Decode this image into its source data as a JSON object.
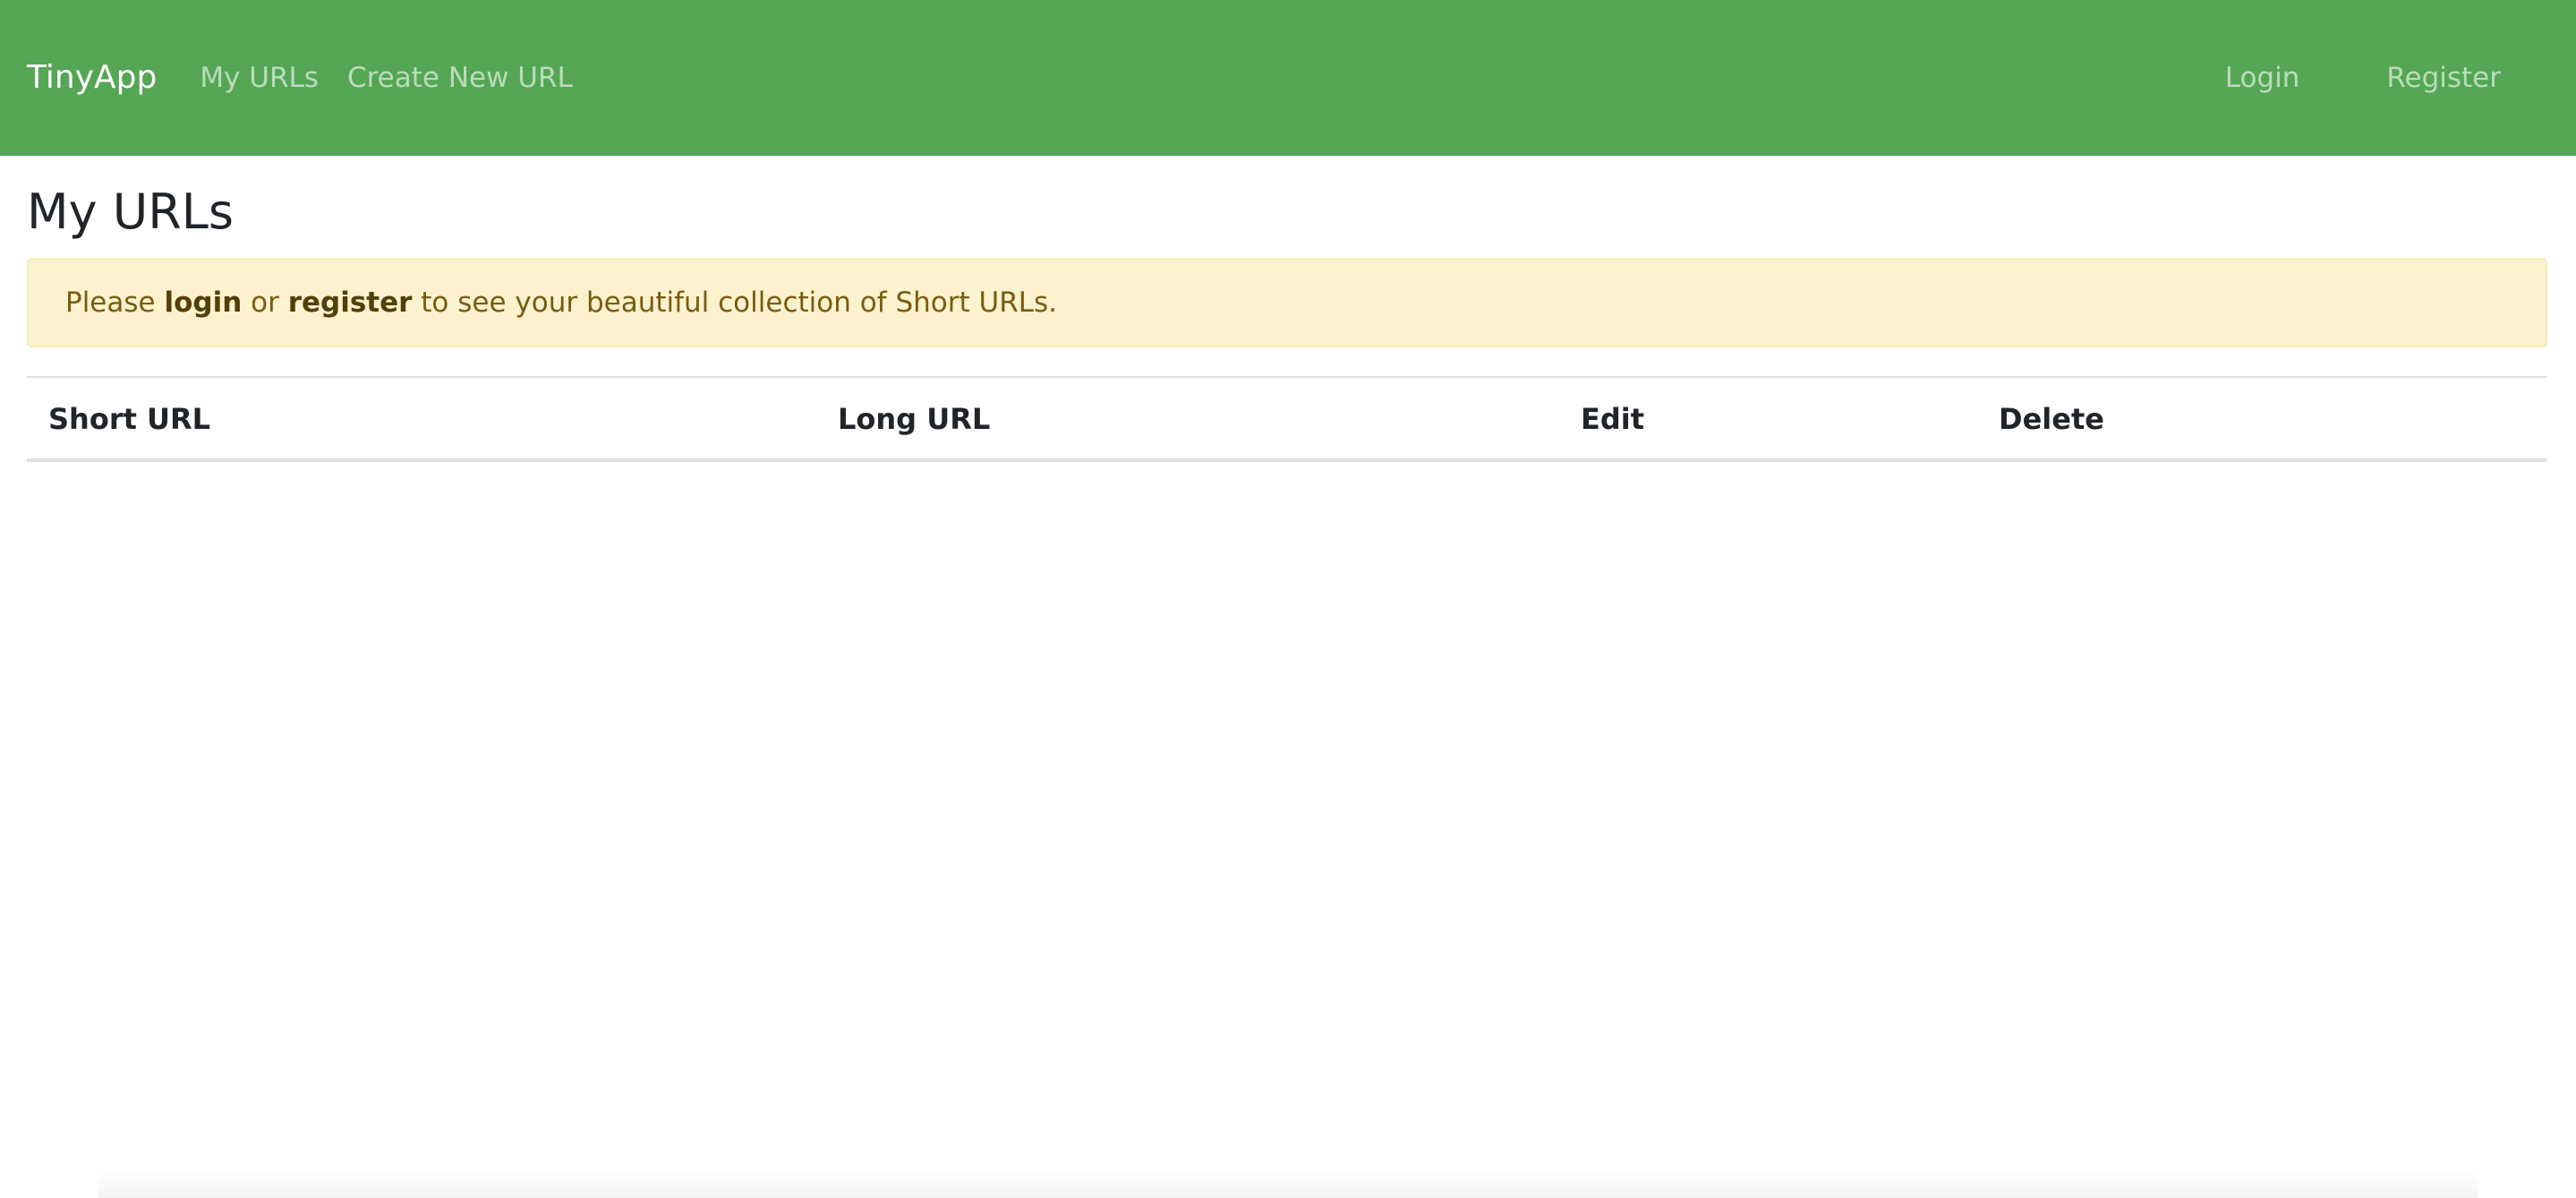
{
  "navbar": {
    "brand": "TinyApp",
    "links_left": [
      {
        "label": "My URLs"
      },
      {
        "label": "Create New URL"
      }
    ],
    "links_right": [
      {
        "label": "Login"
      },
      {
        "label": "Register"
      }
    ]
  },
  "main": {
    "title": "My URLs",
    "alert": {
      "prefix": "Please ",
      "login_label": "login",
      "middle": " or ",
      "register_label": "register",
      "suffix": " to see your beautiful collection of Short URLs."
    },
    "table": {
      "headers": [
        "Short URL",
        "Long URL",
        "Edit",
        "Delete"
      ],
      "rows": []
    }
  },
  "colors": {
    "navbar_bg": "#54a654",
    "alert_bg": "#fcf2cd",
    "alert_text": "#7a5c10"
  }
}
